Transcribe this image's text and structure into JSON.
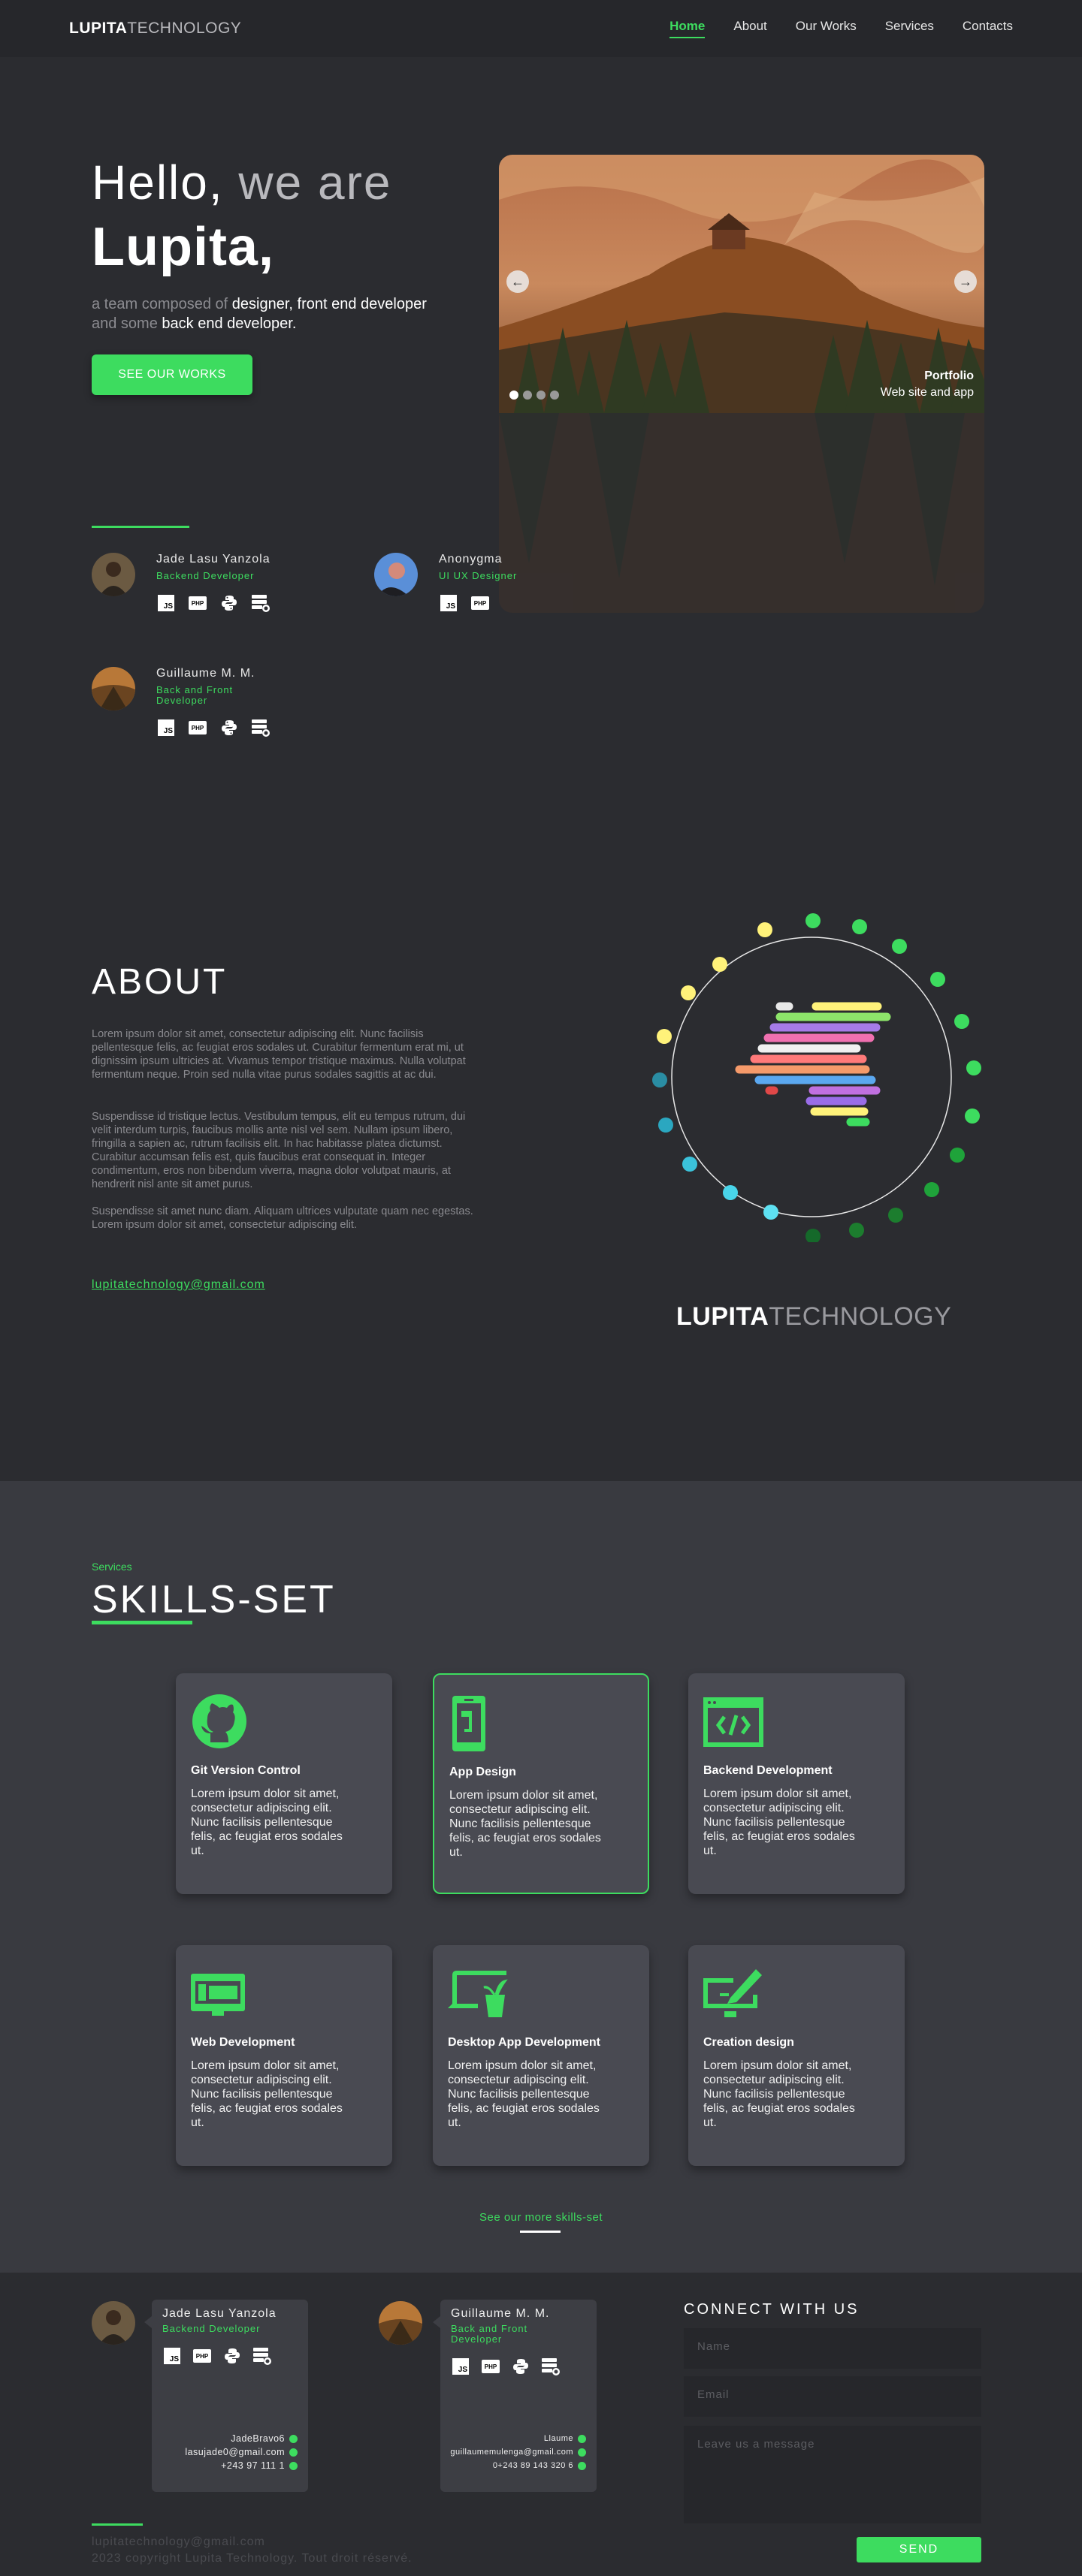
{
  "nav": {
    "brand_bold": "LUPITA",
    "brand_light": "TECHNOLOGY",
    "links": [
      "Home",
      "About",
      "Our Works",
      "Services",
      "Contacts"
    ],
    "active": "Home"
  },
  "hero": {
    "hello": "Hello,",
    "we_are": "we are",
    "name": "Lupita,",
    "tagline_1": "a team composed of ",
    "tagline_2": "designer, front end developer",
    "tagline_3": " and some ",
    "tagline_4": "back end developer.",
    "cta": "SEE OUR WORKS",
    "carousel": {
      "caption_title": "Portfolio",
      "caption_sub": "Web site and app",
      "prev_icon": "arrow-left-icon",
      "next_icon": "arrow-right-icon",
      "slide_count": 4,
      "active_slide": 1
    },
    "members": [
      {
        "name": "Jade Lasu Yanzola",
        "role": "Backend Developer",
        "tech": [
          "JS",
          "PHP",
          "python-icon",
          "database-icon"
        ]
      },
      {
        "name": "Anonygma",
        "role": "UI UX Designer",
        "tech": [
          "JS",
          "PHP"
        ]
      },
      {
        "name": "Guillaume M. M.",
        "role": "Back and Front Developer",
        "tech": [
          "JS",
          "PHP",
          "python-icon",
          "database-icon"
        ]
      }
    ]
  },
  "about": {
    "title": "ABOUT",
    "p1": "Lorem ipsum dolor sit amet, consectetur adipiscing elit. Nunc facilisis pellentesque felis, ac feugiat eros sodales ut. Curabitur fermentum erat mi, ut dignissim ipsum ultricies at. Vivamus tempor tristique maximus. Nulla volutpat fermentum neque. Proin sed nulla vitae purus sodales sagittis at ac dui.",
    "p2": "Suspendisse id tristique lectus. Vestibulum tempus, elit eu tempus rutrum, dui velit interdum turpis, faucibus mollis ante nisl vel sem. Nullam ipsum libero, fringilla a sapien ac, rutrum facilisis elit. In hac habitasse platea dictumst. Curabitur accumsan felis est, quis faucibus erat consequat in. Integer condimentum, eros non bibendum viverra, magna dolor volutpat mauris, at hendrerit nisl ante sit amet purus.",
    "p3": "Suspendisse sit amet nunc diam. Aliquam ultrices vulputate quam nec egestas. Lorem ipsum dolor sit amet, consectetur adipiscing elit.",
    "email": "lupitatechnology@gmail.com",
    "logo_bold": "LUPITA",
    "logo_light": "TECHNOLOGY"
  },
  "skills": {
    "kicker": "Services",
    "title": "SKILLS-SET",
    "cards": [
      {
        "title": "Git Version Control",
        "icon": "github-icon",
        "text": "Lorem ipsum dolor sit amet, consectetur adipiscing elit. Nunc facilisis pellentesque felis, ac feugiat eros sodales ut."
      },
      {
        "title": "App Design",
        "icon": "mobile-app-icon",
        "text": "Lorem ipsum dolor sit amet, consectetur adipiscing elit. Nunc facilisis pellentesque felis, ac feugiat eros sodales ut."
      },
      {
        "title": "Backend Development",
        "icon": "code-window-icon",
        "text": "Lorem ipsum dolor sit amet, consectetur adipiscing elit. Nunc facilisis pellentesque felis, ac feugiat eros sodales ut."
      },
      {
        "title": "Web Development",
        "icon": "web-monitor-icon",
        "text": "Lorem ipsum dolor sit amet, consectetur adipiscing elit. Nunc facilisis pellentesque felis, ac feugiat eros sodales ut."
      },
      {
        "title": "Desktop App Development",
        "icon": "desktop-app-icon",
        "text": "Lorem ipsum dolor sit amet, consectetur adipiscing elit. Nunc facilisis pellentesque felis, ac feugiat eros sodales ut."
      },
      {
        "title": "Creation design",
        "icon": "design-pen-icon",
        "text": "Lorem ipsum dolor sit amet, consectetur adipiscing elit. Nunc facilisis pellentesque felis, ac feugiat eros sodales ut."
      }
    ],
    "more": "See our more skills-set"
  },
  "footer": {
    "cards": [
      {
        "name": "Jade Lasu Yanzola",
        "role": "Backend Developer",
        "github": "JadeBravo6",
        "email": "lasujade0@gmail.com",
        "phone": "+243 97 111 1"
      },
      {
        "name": "Guillaume M. M.",
        "role": "Back and Front Developer",
        "github": "Llaume",
        "email": "guillaumemulenga@gmail.com",
        "phone": "0+243 89 143 320 6"
      }
    ],
    "connect": "CONNECT WITH US",
    "name_placeholder": "Name",
    "email_placeholder": "Email",
    "message_placeholder": "Leave us a message",
    "send": "SEND",
    "email": "lupitatechnology@gmail.com",
    "copyright": "2023 copyright Lupita Technology. Tout droit réservé."
  },
  "colors": {
    "accent": "#3ddc5f",
    "bg": "#2b2c30",
    "card": "#494a52"
  }
}
